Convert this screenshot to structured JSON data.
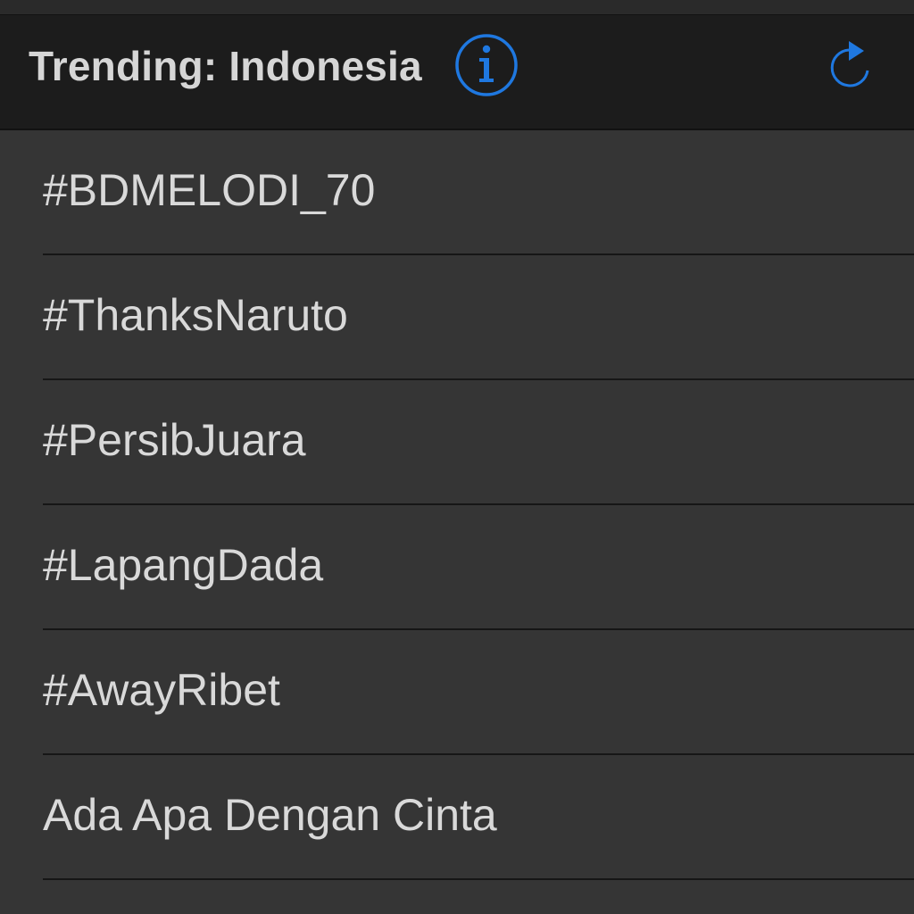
{
  "header": {
    "title": "Trending: Indonesia",
    "info_icon": "info-circle-icon",
    "refresh_icon": "refresh-icon",
    "accent_color": "#1f78e0"
  },
  "trends": [
    {
      "label": "#BDMELODI_70"
    },
    {
      "label": "#ThanksNaruto"
    },
    {
      "label": "#PersibJuara"
    },
    {
      "label": "#LapangDada"
    },
    {
      "label": "#AwayRibet"
    },
    {
      "label": "Ada Apa Dengan Cinta"
    }
  ]
}
